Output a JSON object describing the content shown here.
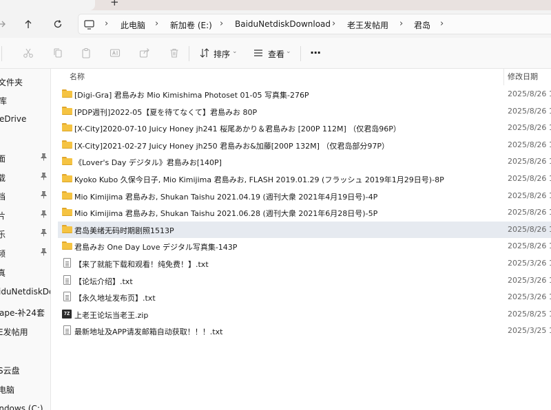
{
  "tabbar": {
    "new_tab_icon": "plus-icon"
  },
  "nav": {
    "forward_icon": "arrow-right-icon",
    "up_icon": "arrow-up-icon",
    "refresh_icon": "refresh-icon"
  },
  "breadcrumb": {
    "monitor_icon": "monitor-icon",
    "items": [
      "此电脑",
      "新加卷 (E:)",
      "BaiduNetdiskDownload",
      "老王发帖用",
      "君岛"
    ]
  },
  "toolbar": {
    "sort_label": "排序",
    "view_label": "查看",
    "more_label": "···"
  },
  "sidebar": {
    "items": [
      {
        "label": "文件夹",
        "pinned": false
      },
      {
        "label": "库",
        "pinned": false
      },
      {
        "label": "eDrive",
        "pinned": false
      },
      {
        "label": "面",
        "pinned": true
      },
      {
        "label": "载",
        "pinned": true
      },
      {
        "label": "档",
        "pinned": true
      },
      {
        "label": "片",
        "pinned": true
      },
      {
        "label": "乐",
        "pinned": true
      },
      {
        "label": "频",
        "pinned": true
      },
      {
        "label": "真",
        "pinned": false
      },
      {
        "label": "iduNetdiskDow",
        "pinned": false
      },
      {
        "label": "ape-补24套",
        "pinned": false
      },
      {
        "label": "E发帖用",
        "pinned": false
      },
      {
        "label": "S云盘",
        "pinned": false
      },
      {
        "label": "电脑",
        "pinned": false
      },
      {
        "label": "indows (C:)",
        "pinned": false
      }
    ]
  },
  "columns": {
    "name": "名称",
    "modified": "修改日期"
  },
  "files": [
    {
      "type": "folder",
      "name": "[Digi-Gra] 君島みお Mio Kimishima Photoset 01-05 写真集-276P",
      "date": "2025/8/26 1"
    },
    {
      "type": "folder",
      "name": "[PDP週刊]2022-05【夏を待てなくて】君島みお 80P",
      "date": "2025/8/26 1"
    },
    {
      "type": "folder",
      "name": "[X-City]2020-07-10 Juicy Honey jh241 桜尾あかり＆君島みお [200P 112M] （仅君岛96P）",
      "date": "2025/8/26 1"
    },
    {
      "type": "folder",
      "name": "[X-City]2021-02-27 Juicy Honey jh250 君島みお&加藤[200P 132M] （仅君岛部分97P）",
      "date": "2025/8/26 1"
    },
    {
      "type": "folder",
      "name": "《Lover's Day デジタル》君島みお[140P]",
      "date": "2025/8/26 1"
    },
    {
      "type": "folder",
      "name": "Kyoko Kubo 久保今日子, Mio Kimijima 君島みお, FLASH 2019.01.29 (フラッシュ 2019年1月29日号)-8P",
      "date": "2025/8/26 1"
    },
    {
      "type": "folder",
      "name": "Mio Kimijima 君島みお, Shukan Taishu 2021.04.19 (週刊大衆 2021年4月19日号)-4P",
      "date": "2025/8/26 1"
    },
    {
      "type": "folder",
      "name": "Mio Kimijima 君島みお, Shukan Taishu 2021.06.28 (週刊大衆 2021年6月28日号)-5P",
      "date": "2025/8/26 1"
    },
    {
      "type": "folder",
      "name": "君岛美绪无码时期剧照1513P",
      "date": "2025/8/26 1",
      "selected": true
    },
    {
      "type": "folder",
      "name": "君島みお One Day Love デジタル写真集-143P",
      "date": "2025/8/26 1"
    },
    {
      "type": "txt",
      "name": "【来了就能下载和观看！纯免费！】.txt",
      "date": "2025/3/26 1"
    },
    {
      "type": "txt",
      "name": "【论坛介绍】.txt",
      "date": "2025/3/26 1"
    },
    {
      "type": "txt",
      "name": "【永久地址发布页】.txt",
      "date": "2025/3/26 1"
    },
    {
      "type": "zip",
      "name": "上老王论坛当老王.zip",
      "date": "2025/8/25 1",
      "icon_text": "7Z"
    },
    {
      "type": "txt",
      "name": "最新地址及APP请发邮箱自动获取！！！.txt",
      "date": "2025/3/25 1"
    }
  ]
}
